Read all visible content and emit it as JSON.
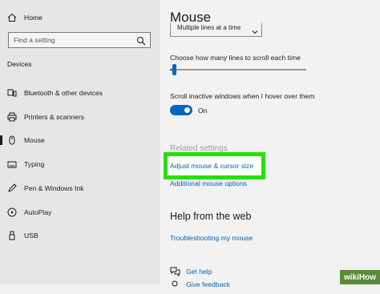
{
  "sidebar": {
    "home": "Home",
    "search_placeholder": "Find a setting",
    "section": "Devices",
    "items": [
      {
        "label": "Bluetooth & other devices",
        "icon": "bluetooth-devices-icon"
      },
      {
        "label": "Printers & scanners",
        "icon": "printer-icon"
      },
      {
        "label": "Mouse",
        "icon": "mouse-icon",
        "selected": true
      },
      {
        "label": "Typing",
        "icon": "keyboard-icon"
      },
      {
        "label": "Pen & Windows Ink",
        "icon": "pen-icon"
      },
      {
        "label": "AutoPlay",
        "icon": "autoplay-icon"
      },
      {
        "label": "USB",
        "icon": "usb-icon"
      }
    ]
  },
  "main": {
    "title": "Mouse",
    "scroll_dropdown_value": "Multiple lines at a time",
    "lines_label": "Choose how many lines to scroll each time",
    "lines_value_fraction": 0.03,
    "inactive_label": "Scroll inactive windows when I hover over them",
    "toggle_state": "On",
    "related_heading": "Related settings",
    "related_links": [
      "Adjust mouse & cursor size",
      "Additional mouse options"
    ],
    "help_heading": "Help from the web",
    "help_link": "Troubleshooting my mouse",
    "get_help": "Get help",
    "feedback": "Give feedback"
  },
  "watermark": "wikiHow",
  "colors": {
    "accent": "#0067c0",
    "link": "#0063b1",
    "highlight": "#26e000",
    "sidebar_bg": "#e6e6e6"
  }
}
